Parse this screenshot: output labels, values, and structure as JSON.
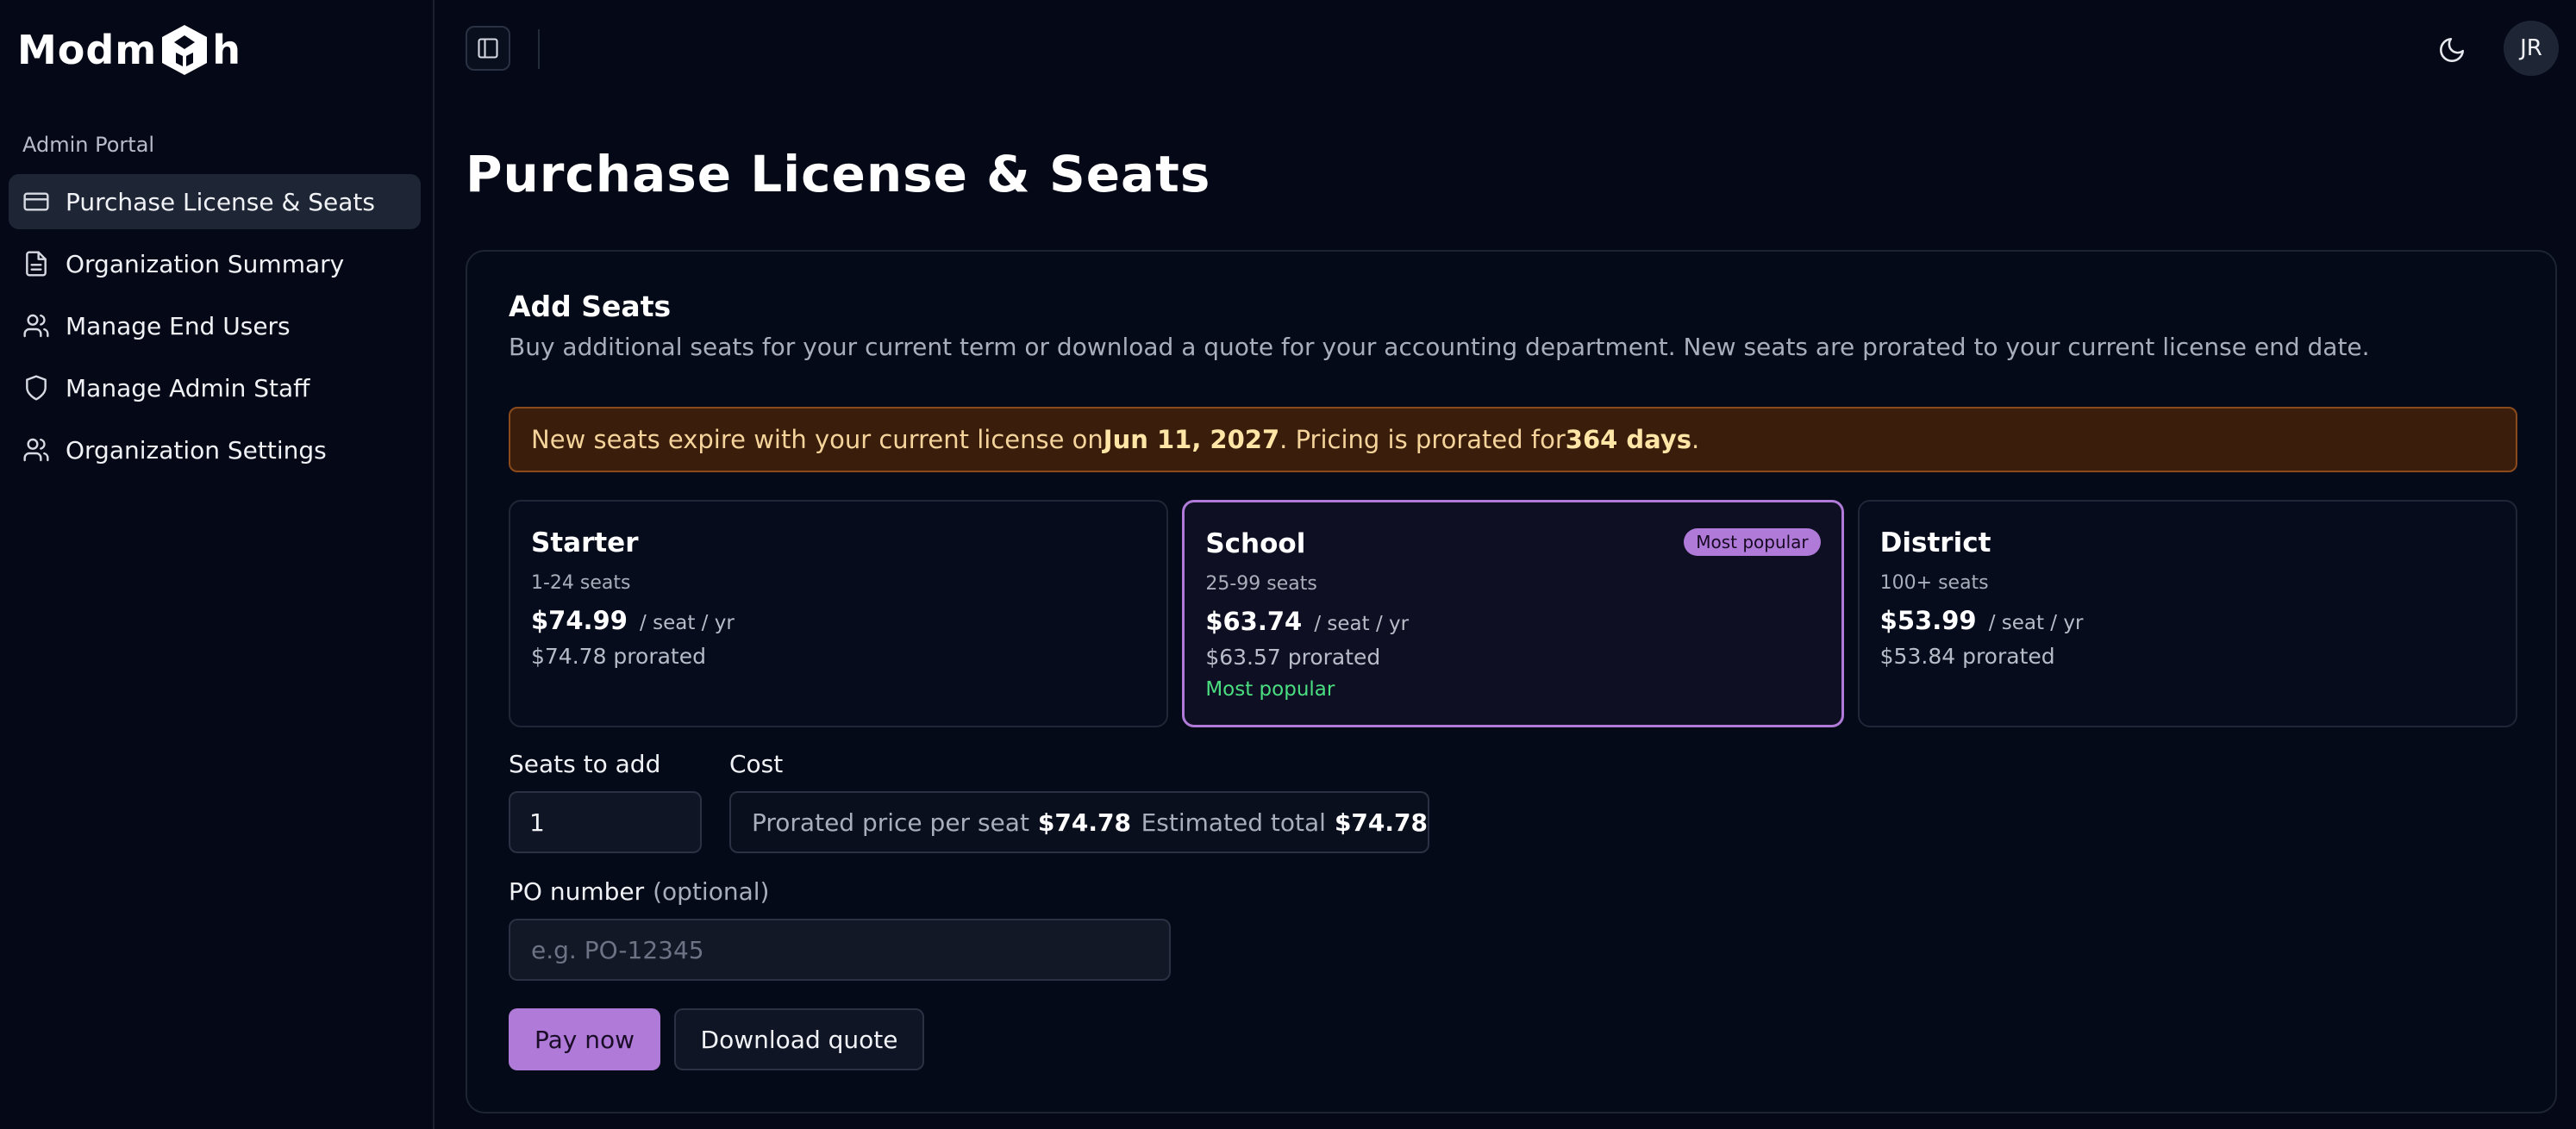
{
  "brand": {
    "name_left": "Modm",
    "name_right": "h"
  },
  "sidebar": {
    "section_label": "Admin Portal",
    "items": [
      {
        "label": "Purchase License & Seats",
        "icon": "credit-card-icon",
        "active": true
      },
      {
        "label": "Organization Summary",
        "icon": "document-icon",
        "active": false
      },
      {
        "label": "Manage End Users",
        "icon": "users-icon",
        "active": false
      },
      {
        "label": "Manage Admin Staff",
        "icon": "shield-icon",
        "active": false
      },
      {
        "label": "Organization Settings",
        "icon": "users-gear-icon",
        "active": false
      }
    ]
  },
  "header": {
    "avatar_initials": "JR"
  },
  "page": {
    "title": "Purchase License & Seats"
  },
  "add_seats": {
    "title": "Add Seats",
    "description": "Buy additional seats for your current term or download a quote for your accounting department. New seats are prorated to your current license end date.",
    "notice": {
      "prefix": "New seats expire with your current license on ",
      "date": "Jun 11, 2027",
      "middle": ". Pricing is prorated for ",
      "days": "364 days",
      "suffix": "."
    },
    "plans": [
      {
        "name": "Starter",
        "seats": "1-24 seats",
        "price": "$74.99",
        "unit": "/ seat / yr",
        "prorated": "$74.78 prorated"
      },
      {
        "name": "School",
        "seats": "25-99 seats",
        "price": "$63.74",
        "unit": "/ seat / yr",
        "prorated": "$63.57 prorated",
        "badge": "Most popular",
        "popular_text": "Most popular"
      },
      {
        "name": "District",
        "seats": "100+ seats",
        "price": "$53.99",
        "unit": "/ seat / yr",
        "prorated": "$53.84 prorated"
      }
    ],
    "seats_label": "Seats to add",
    "seats_value": "1",
    "cost_label": "Cost",
    "cost": {
      "per_seat_label": "Prorated price per seat",
      "per_seat_value": "$74.78",
      "total_label": "Estimated total",
      "total_value": "$74.78"
    },
    "po_label": "PO number",
    "po_optional": "(optional)",
    "po_placeholder": "e.g. PO-12345",
    "pay_label": "Pay now",
    "quote_label": "Download quote"
  },
  "colors": {
    "background": "#050917",
    "accent": "#b07ad8",
    "notice_bg": "#3a1d0a",
    "popular_green": "#4ade80"
  }
}
